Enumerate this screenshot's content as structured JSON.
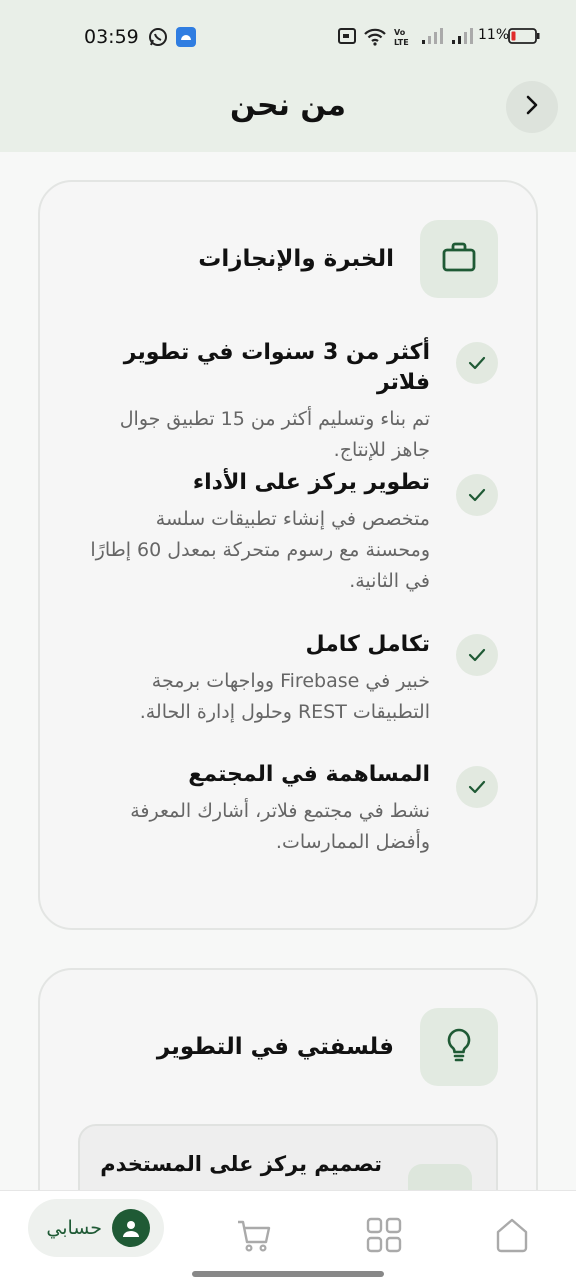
{
  "status_bar": {
    "time": "03:59",
    "battery": "11%"
  },
  "header": {
    "title": "من نحن"
  },
  "experience": {
    "title": "الخبرة والإنجازات",
    "items": [
      {
        "title": "أكثر من 3 سنوات في تطوير فلاتر",
        "desc": "تم بناء وتسليم أكثر من 15 تطبيق جوال جاهز للإنتاج."
      },
      {
        "title": "تطوير يركز على الأداء",
        "desc": "متخصص في إنشاء تطبيقات سلسة ومحسنة مع رسوم متحركة بمعدل 60 إطارًا في الثانية."
      },
      {
        "title": "تكامل كامل",
        "desc": "خبير في Firebase وواجهات برمجة التطبيقات REST وحلول إدارة الحالة."
      },
      {
        "title": "المساهمة في المجتمع",
        "desc": "نشط في مجتمع فلاتر، أشارك المعرفة وأفضل الممارسات."
      }
    ]
  },
  "philosophy": {
    "title": "فلسفتي في التطوير",
    "items": [
      {
        "title": "تصميم يركز على المستخدم"
      }
    ]
  },
  "bottom_nav": {
    "account_label": "حسابي"
  },
  "colors": {
    "accent": "#1f5a35",
    "icon_bg": "#e2eae1"
  }
}
